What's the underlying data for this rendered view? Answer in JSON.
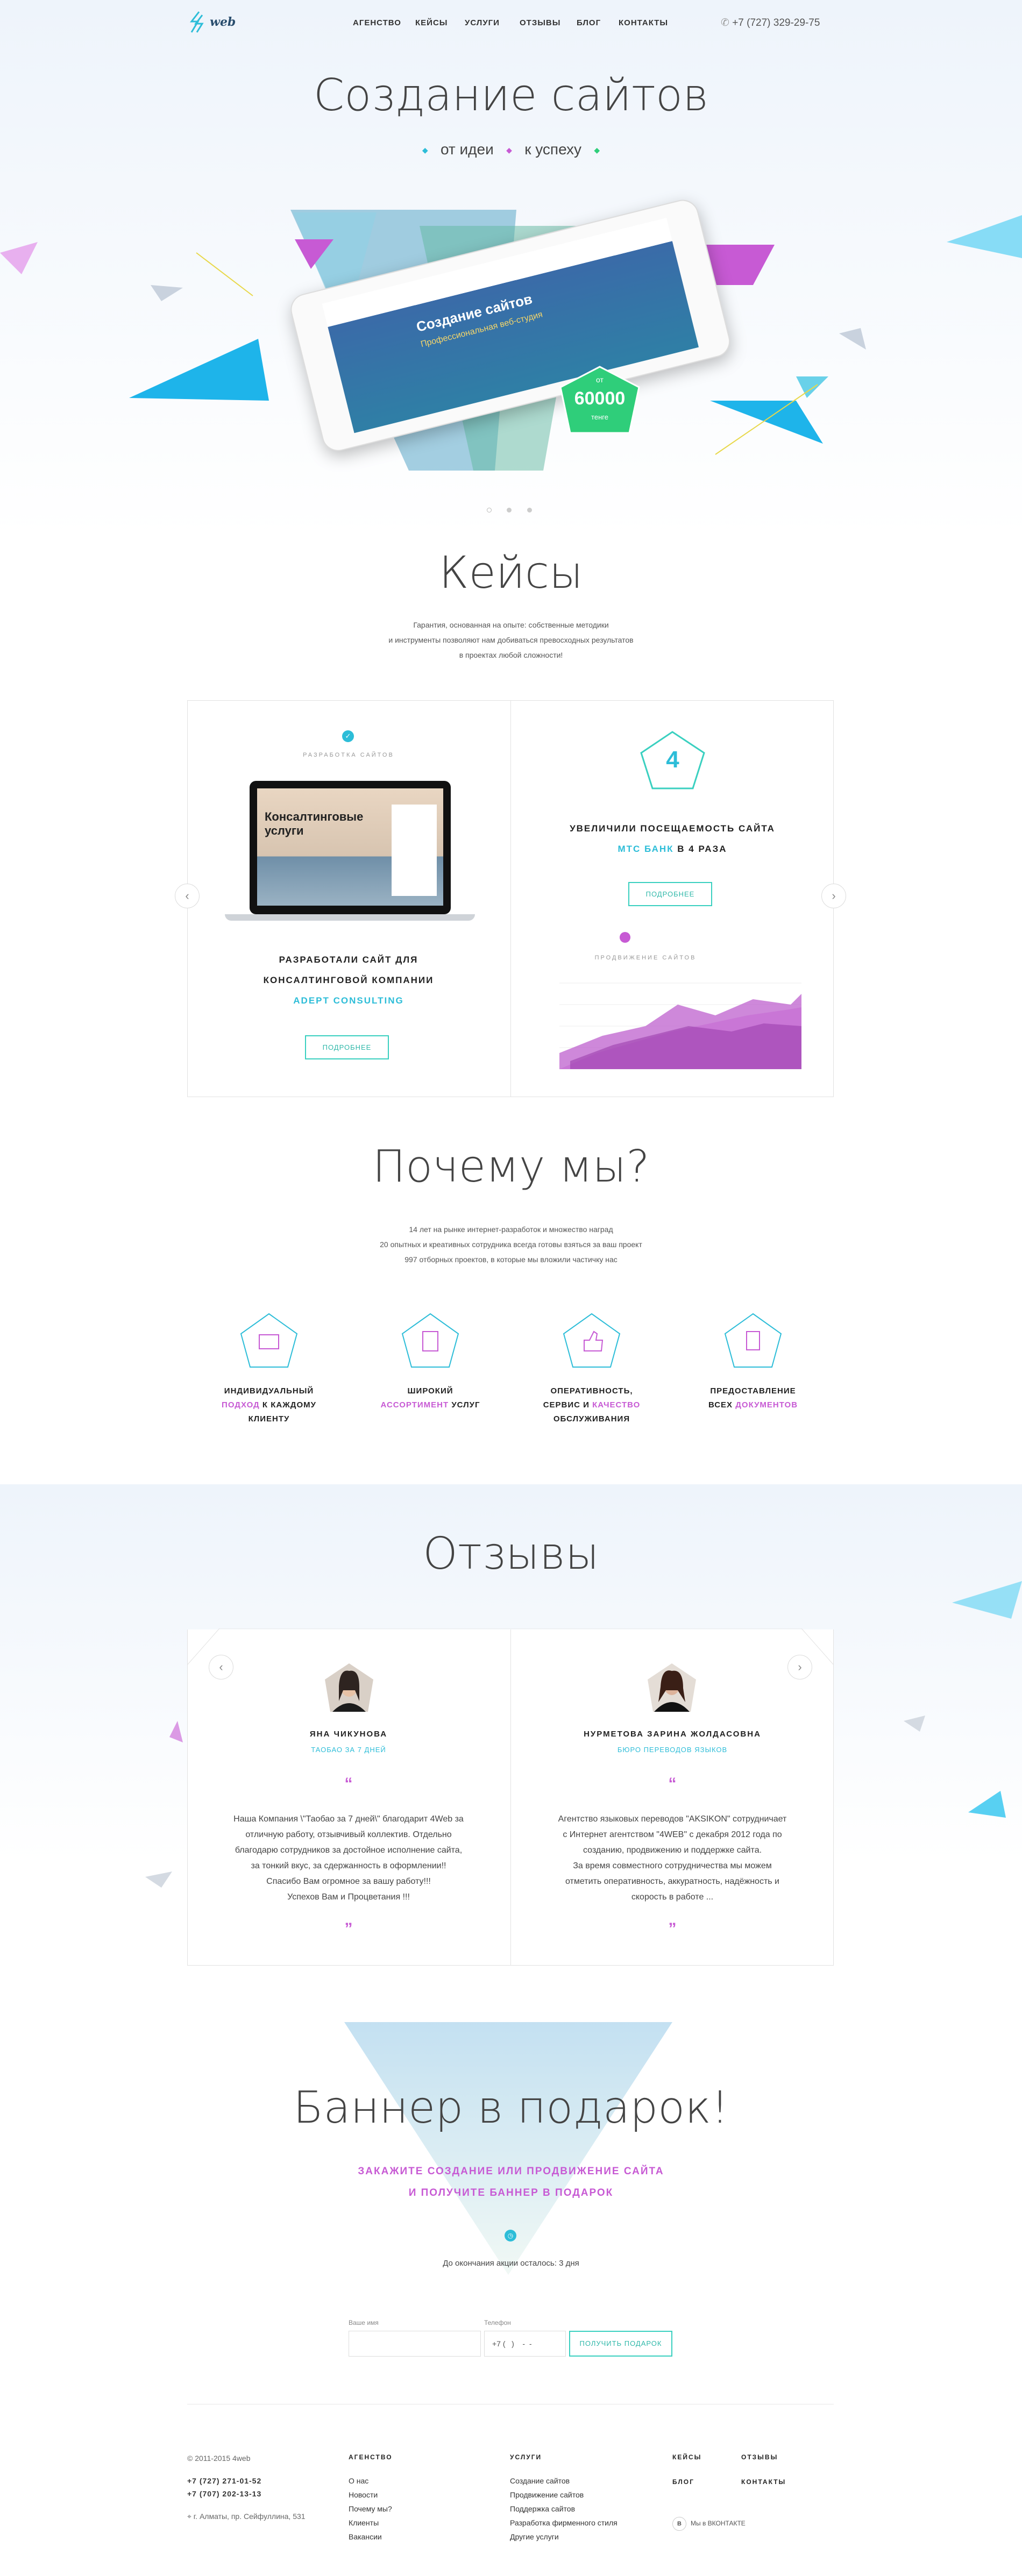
{
  "header": {
    "logo": "web",
    "nav": [
      "АГЕНСТВО",
      "КЕЙСЫ",
      "УСЛУГИ",
      "ОТЗЫВЫ",
      "БЛОГ",
      "КОНТАКТЫ"
    ],
    "phone": "+7 (727) 329-29-75"
  },
  "hero": {
    "title": "Создание сайтов",
    "sub_from": "от идеи",
    "sub_to": "к успеху",
    "tablet_line1": "Создание сайтов",
    "tablet_line2": "Профессиональная веб-студия",
    "badge_from": "от",
    "badge_price": "60000",
    "badge_currency": "тенге"
  },
  "cases": {
    "title": "Кейсы",
    "intro": [
      "Гарантия, основанная на опыте: собственные методики",
      "и инструменты позволяют нам добиваться превосходных результатов",
      "в проектах любой сложности!"
    ],
    "left": {
      "label": "РАЗРАБОТКА САЙТОВ",
      "screen_title": "Консалтинговые услуги",
      "line1": "РАЗРАБОТАЛИ САЙТ ДЛЯ",
      "line2": "КОНСАЛТИНГОВОЙ КОМПАНИИ",
      "client": "ADEPT CONSULTING",
      "button": "ПОДРОБНЕЕ"
    },
    "right": {
      "badge": "4",
      "line1": "УВЕЛИЧИЛИ ПОСЕЩАЕМОСТЬ САЙТА",
      "client": "МТС БАНК",
      "suffix": " В 4 РАЗА",
      "button": "ПОДРОБНЕЕ",
      "label": "ПРОДВИЖЕНИЕ САЙТОВ"
    },
    "prev": "‹",
    "next": "›"
  },
  "why": {
    "title": "Почему мы?",
    "intro": [
      "14 лет на рынке интернет-разработок и множество наград",
      "20 опытных и креативных сотрудника всегда готовы взяться за ваш проект",
      "997 отборных проектов, в которые мы вложили частичку нас"
    ],
    "features": [
      {
        "a": "ИНДИВИДУАЛЬНЫЙ",
        "b": "ПОДХОД",
        "c": " К КАЖДОМУ",
        "d": "КЛИЕНТУ"
      },
      {
        "a": "ШИРОКИЙ",
        "b": "АССОРТИМЕНТ",
        "c": " УСЛУГ",
        "d": ""
      },
      {
        "a": "ОПЕРАТИВНОСТЬ,",
        "b": "СЕРВИС И ",
        "c": "КАЧЕСТВО",
        "d": "ОБСЛУЖИВАНИЯ"
      },
      {
        "a": "ПРЕДОСТАВЛЕНИЕ",
        "b": "ВСЕХ ",
        "c": "ДОКУМЕНТОВ",
        "d": ""
      }
    ]
  },
  "reviews": {
    "title": "Отзывы",
    "items": [
      {
        "name": "ЯНА ЧИКУНОВА",
        "company": "ТАОБАО ЗА 7 ДНЕЙ",
        "text": [
          "Наша Компания \\\"Таобао за 7 дней\\\" благодарит 4Web за",
          "отличную работу, отзывчивый коллектив. Отдельно",
          "благодарю сотрудников за достойное исполнение сайта,",
          "за тонкий вкус, за сдержанность в оформлении!!",
          "Спасибо Вам огромное за вашу работу!!!",
          "Успехов Вам и Процветания !!!"
        ]
      },
      {
        "name": "НУРМЕТОВА ЗАРИНА ЖОЛДАСОВНА",
        "company": "БЮРО ПЕРЕВОДОВ ЯЗЫКОВ",
        "text": [
          "Агентство языковых переводов \"AKSIKON\" сотрудничает",
          "с Интернет агентством \"4WEB\" с декабря 2012 года по",
          "созданию, продвижению и поддержке сайта.",
          "За время совместного сотрудничества мы можем",
          "отметить оперативность, аккуратность, надёжность и",
          "скорость в работе ..."
        ]
      }
    ]
  },
  "banner": {
    "title": "Баннер в подарок!",
    "line1": "ЗАКАЖИТЕ СОЗДАНИЕ ИЛИ ПРОДВИЖЕНИЕ САЙТА",
    "line2": "И ПОЛУЧИТЕ БАННЕР В ПОДАРОК",
    "deadline": "До окончания акции осталось: 3 дня",
    "name_label": "Ваше имя",
    "phone_label": "Телефон",
    "phone_value": "+7 (   )    -  -",
    "submit": "ПОЛУЧИТЬ ПОДАРОК"
  },
  "footer": {
    "copy": "© 2011-2015 4web",
    "phone1": "+7 (727) 271-01-52",
    "phone2": "+7 (707) 202-13-13",
    "address": "г. Алматы, пр. Сейфуллина, 531",
    "agency_h": "АГЕНСТВО",
    "agency": [
      "О нас",
      "Новости",
      "Почему мы?",
      "Клиенты",
      "Вакансии"
    ],
    "services_h": "УСЛУГИ",
    "services": [
      "Создание сайтов",
      "Продвижение сайтов",
      "Поддержка сайтов",
      "Разработка фирменного стиля",
      "Другие услуги"
    ],
    "col3": [
      "КЕЙСЫ",
      "БЛОГ"
    ],
    "col4": [
      "ОТЗЫВЫ",
      "КОНТАКТЫ"
    ],
    "vk": "Мы в ВКОНТАКТЕ"
  },
  "colors": {
    "accent_cyan": "#2dbdd8",
    "accent_purple": "#c75ad4",
    "teal": "#3ad0c0",
    "green": "#2fce7a"
  }
}
